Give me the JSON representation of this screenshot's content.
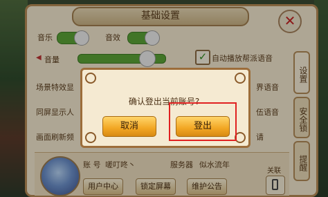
{
  "settings": {
    "title": "基础设置",
    "close_icon": "close-icon",
    "tabs": [
      "设置",
      "安全锁",
      "提醒"
    ],
    "music_label": "音乐",
    "sound_label": "音效",
    "volume_label": "音量",
    "volume_level": 0.85,
    "auto_voice_label": "自动播放帮派语音",
    "scene_effect_label": "场景特效显",
    "same_screen_label": "同屏显示人",
    "refresh_label": "画面刷新频",
    "right_partial_1": "界语音",
    "right_partial_2": "伍语音",
    "right_partial_3": "请"
  },
  "user": {
    "account_label": "账 号",
    "account_value": "嗟叮咚丶",
    "server_label": "服务器",
    "server_value": "似水流年",
    "link_label": "关联",
    "buttons": [
      "用户中心",
      "锁定屏幕",
      "维护公告"
    ]
  },
  "dialog": {
    "message": "确认登出当前账号?",
    "cancel_label": "取消",
    "confirm_label": "登出"
  },
  "colors": {
    "accent_green": "#5aa236",
    "button_gold": "#f2a623",
    "highlight_red": "#e02020"
  }
}
